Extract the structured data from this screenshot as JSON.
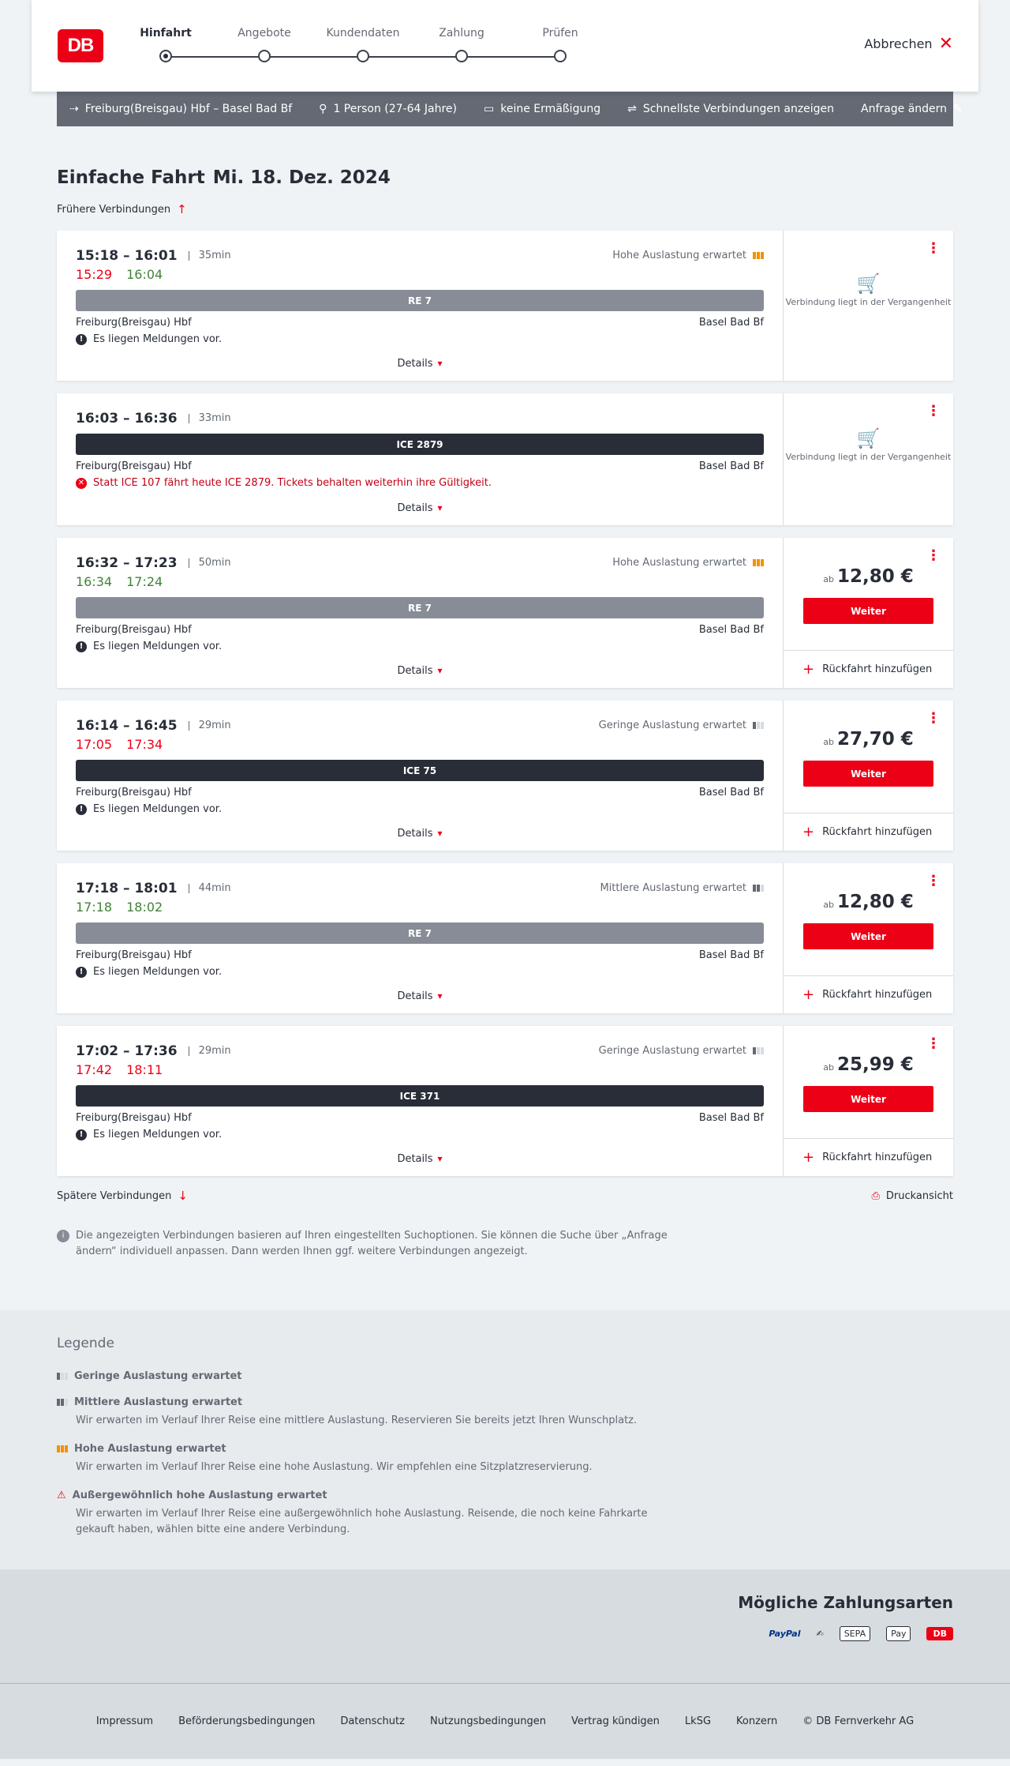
{
  "header": {
    "logo": "DB",
    "steps": [
      {
        "label": "Hinfahrt"
      },
      {
        "label": "Angebote"
      },
      {
        "label": "Kundendaten"
      },
      {
        "label": "Zahlung"
      },
      {
        "label": "Prüfen"
      }
    ],
    "cancel_label": "Abbrechen"
  },
  "query": {
    "route": "Freiburg(Breisgau) Hbf – Basel Bad Bf",
    "passengers": "1 Person (27-64 Jahre)",
    "discount": "keine Ermäßigung",
    "fastest": "Schnellste Verbindungen anzeigen",
    "change": "Anfrage ändern"
  },
  "page": {
    "title_bold": "Einfache Fahrt",
    "title_date": "Mi. 18. Dez. 2024",
    "earlier": "Frühere Verbindungen",
    "later": "Spätere Verbindungen",
    "print": "Druckansicht",
    "info": "Die angezeigten Verbindungen basieren auf Ihren eingestellten Suchoptionen. Sie können die Suche über „Anfrage ändern“ individuell anpassen. Dann werden Ihnen ggf. weitere Verbindungen angezeigt."
  },
  "connections": [
    {
      "times": "15:18 – 16:01",
      "duration": "35min",
      "occupancy": "Hohe Auslastung erwartet",
      "rt_dep": "15:29",
      "rt_arr": "16:04",
      "train": "RE 7",
      "from": "Freiburg(Breisgau) Hbf",
      "to": "Basel Bad Bf",
      "message": "Es liegen Meldungen vor.",
      "details": "Details",
      "past": "Verbindung liegt in der Vergangenheit"
    },
    {
      "times": "16:03 – 16:36",
      "duration": "33min",
      "train": "ICE 2879",
      "from": "Freiburg(Breisgau) Hbf",
      "to": "Basel Bad Bf",
      "message": "Statt ICE 107 fährt heute ICE 2879. Tickets behalten weiterhin ihre Gültigkeit.",
      "details": "Details",
      "past": "Verbindung liegt in der Vergangenheit"
    },
    {
      "times": "16:32 – 17:23",
      "duration": "50min",
      "occupancy": "Hohe Auslastung erwartet",
      "rt_dep": "16:34",
      "rt_arr": "17:24",
      "train": "RE 7",
      "from": "Freiburg(Breisgau) Hbf",
      "to": "Basel Bad Bf",
      "message": "Es liegen Meldungen vor.",
      "details": "Details",
      "price_prefix": "ab",
      "price": "12,80 €",
      "button": "Weiter",
      "return": "Rückfahrt hinzufügen"
    },
    {
      "times": "16:14 – 16:45",
      "duration": "29min",
      "occupancy": "Geringe Auslastung erwartet",
      "rt_dep": "17:05",
      "rt_arr": "17:34",
      "train": "ICE 75",
      "from": "Freiburg(Breisgau) Hbf",
      "to": "Basel Bad Bf",
      "message": "Es liegen Meldungen vor.",
      "details": "Details",
      "price_prefix": "ab",
      "price": "27,70 €",
      "button": "Weiter",
      "return": "Rückfahrt hinzufügen"
    },
    {
      "times": "17:18 – 18:01",
      "duration": "44min",
      "occupancy": "Mittlere Auslastung erwartet",
      "rt_dep": "17:18",
      "rt_arr": "18:02",
      "train": "RE 7",
      "from": "Freiburg(Breisgau) Hbf",
      "to": "Basel Bad Bf",
      "message": "Es liegen Meldungen vor.",
      "details": "Details",
      "price_prefix": "ab",
      "price": "12,80 €",
      "button": "Weiter",
      "return": "Rückfahrt hinzufügen"
    },
    {
      "times": "17:02 – 17:36",
      "duration": "29min",
      "occupancy": "Geringe Auslastung erwartet",
      "rt_dep": "17:42",
      "rt_arr": "18:11",
      "train": "ICE 371",
      "from": "Freiburg(Breisgau) Hbf",
      "to": "Basel Bad Bf",
      "message": "Es liegen Meldungen vor.",
      "details": "Details",
      "price_prefix": "ab",
      "price": "25,99 €",
      "button": "Weiter",
      "return": "Rückfahrt hinzufügen"
    }
  ],
  "legend": {
    "title": "Legende",
    "items": [
      {
        "title": "Geringe Auslastung erwartet",
        "desc": ""
      },
      {
        "title": "Mittlere Auslastung erwartet",
        "desc": "Wir erwarten im Verlauf Ihrer Reise eine mittlere Auslastung. Reservieren Sie bereits jetzt Ihren Wunschplatz."
      },
      {
        "title": "Hohe Auslastung erwartet",
        "desc": "Wir erwarten im Verlauf Ihrer Reise eine hohe Auslastung. Wir empfehlen eine Sitzplatzreservierung."
      },
      {
        "title": "Außergewöhnlich hohe Auslastung erwartet",
        "desc": "Wir erwarten im Verlauf Ihrer Reise eine außergewöhnlich hohe Auslastung. Reisende, die noch keine Fahrkarte gekauft haben, wählen bitte eine andere Verbindung."
      }
    ]
  },
  "payment": {
    "title": "Mögliche Zahlungsarten",
    "methods": [
      "PayPal",
      "SEPA",
      "Pay",
      "DB"
    ]
  },
  "footer": {
    "links": [
      "Impressum",
      "Beförderungsbedingungen",
      "Datenschutz",
      "Nutzungsbedingungen",
      "Vertrag kündigen",
      "LkSG",
      "Konzern",
      "© DB Fernverkehr AG"
    ]
  },
  "colors": {
    "accent": "#ec0016",
    "bar": "#646973",
    "ontime": "#408335",
    "late": "#ec0016",
    "high_occupancy": "#f39200"
  }
}
